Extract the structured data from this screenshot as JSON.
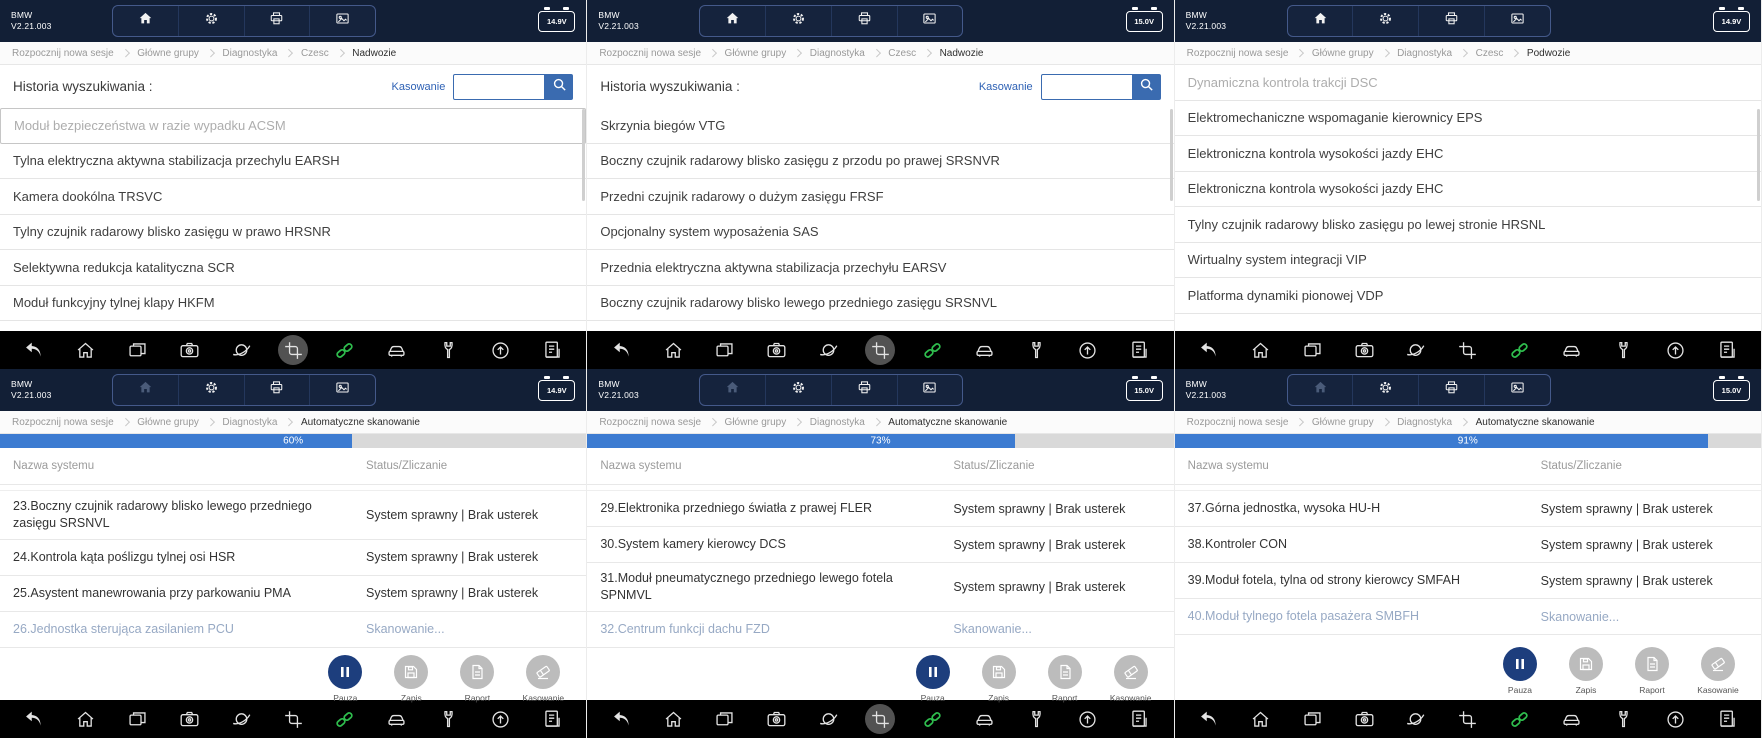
{
  "app": {
    "brand": "BMW",
    "version": "V2.21.003"
  },
  "labels": {
    "history": "Historia wyszukiwania :",
    "clear": "Kasowanie",
    "col_system": "Nazwa systemu",
    "col_status": "Status/Zliczanie",
    "actions": [
      "Pauza",
      "Zapis",
      "Raport",
      "Kasowanie"
    ]
  },
  "icons": {
    "top_nav": [
      "home-icon",
      "settings-icon",
      "printer-icon",
      "gallery-icon"
    ],
    "system_bar": [
      "back-icon",
      "home-icon",
      "recent-apps-icon",
      "screenshot-icon",
      "clean-icon",
      "crop-icon",
      "link-icon",
      "vehicle-icon",
      "tools-icon",
      "update-icon",
      "report-icon"
    ],
    "search": "magnifier-icon",
    "actions": [
      "pause-icon",
      "save-icon",
      "report-icon",
      "eraser-icon"
    ]
  },
  "colors": {
    "header_navy": "#121f36",
    "accent_blue": "#3a6bb0",
    "progress_blue": "#3c7bd1",
    "pause_navy": "#1d3e7d",
    "link_green": "#2fbe4e",
    "scanning_text": "#97a9c4"
  },
  "panels": [
    {
      "type": "list",
      "battery": "14.9V",
      "home_dimmed": false,
      "crop_ripple": true,
      "has_search": true,
      "breadcrumb": [
        "Rozpocznij nowa sesje",
        "Główne grupy",
        "Diagnostyka",
        "Czesc",
        "Nadwozie"
      ],
      "items": [
        {
          "text": "Moduł bezpieczeństwa w razie wypadku ACSM",
          "state": "selected"
        },
        {
          "text": "Tylna elektryczna aktywna stabilizacja przechylu EARSH",
          "state": "normal"
        },
        {
          "text": "Kamera dookólna TRSVC",
          "state": "normal"
        },
        {
          "text": "Tylny czujnik radarowy blisko zasięgu w prawo HRSNR",
          "state": "normal"
        },
        {
          "text": "Selektywna redukcja katalityczna SCR",
          "state": "normal"
        },
        {
          "text": "Moduł funkcyjny tylnej klapy HKFM",
          "state": "normal"
        }
      ]
    },
    {
      "type": "list",
      "battery": "15.0V",
      "home_dimmed": false,
      "crop_ripple": true,
      "has_search": true,
      "breadcrumb": [
        "Rozpocznij nowa sesje",
        "Główne grupy",
        "Diagnostyka",
        "Czesc",
        "Nadwozie"
      ],
      "items": [
        {
          "text": "Skrzynia biegów VTG",
          "state": "normal"
        },
        {
          "text": "Boczny czujnik radarowy blisko zasięgu z przodu po prawej SRSNVR",
          "state": "normal"
        },
        {
          "text": "Przedni czujnik radarowy o dużym zasięgu FRSF",
          "state": "normal"
        },
        {
          "text": "Opcjonalny system wyposażenia SAS",
          "state": "normal"
        },
        {
          "text": "Przednia elektryczna aktywna stabilizacja przechyłu EARSV",
          "state": "normal"
        },
        {
          "text": "Boczny czujnik radarowy blisko lewego przedniego zasięgu SRSNVL",
          "state": "normal"
        }
      ]
    },
    {
      "type": "list",
      "battery": "14.9V",
      "home_dimmed": false,
      "crop_ripple": false,
      "has_search": false,
      "breadcrumb": [
        "Rozpocznij nowa sesje",
        "Główne grupy",
        "Diagnostyka",
        "Czesc",
        "Podwozie"
      ],
      "items": [
        {
          "text": "Dynamiczna kontrola trakcji DSC",
          "state": "dimmed"
        },
        {
          "text": "Elektromechaniczne wspomaganie kierownicy EPS",
          "state": "normal"
        },
        {
          "text": "Elektroniczna kontrola wysokości jazdy EHC",
          "state": "normal"
        },
        {
          "text": "Elektroniczna kontrola wysokości jazdy EHC",
          "state": "normal"
        },
        {
          "text": "Tylny czujnik radarowy blisko zasięgu po lewej stronie HRSNL",
          "state": "normal"
        },
        {
          "text": "Wirtualny system integracji VIP",
          "state": "normal"
        },
        {
          "text": "Platforma dynamiki pionowej VDP",
          "state": "normal"
        }
      ]
    },
    {
      "type": "scan",
      "battery": "14.9V",
      "home_dimmed": true,
      "crop_ripple": false,
      "breadcrumb": [
        "Rozpocznij nowa sesje",
        "Główne grupy",
        "Diagnostyka",
        "Automatyczne skanowanie"
      ],
      "progress": {
        "value": 60,
        "label": "60%"
      },
      "rows": [
        {
          "name": "23.Boczny czujnik radarowy blisko lewego przedniego zasięgu SRSNVL",
          "status": "System sprawny | Brak usterek",
          "state": "ok"
        },
        {
          "name": "24.Kontrola kąta poślizgu tylnej osi HSR",
          "status": "System sprawny | Brak usterek",
          "state": "ok"
        },
        {
          "name": "25.Asystent manewrowania przy parkowaniu PMA",
          "status": "System sprawny | Brak usterek",
          "state": "ok"
        },
        {
          "name": "26.Jednostka sterująca zasilaniem PCU",
          "status": "Skanowanie...",
          "state": "scanning"
        }
      ]
    },
    {
      "type": "scan",
      "battery": "15.0V",
      "home_dimmed": true,
      "crop_ripple": true,
      "breadcrumb": [
        "Rozpocznij nowa sesje",
        "Główne grupy",
        "Diagnostyka",
        "Automatyczne skanowanie"
      ],
      "progress": {
        "value": 73,
        "label": "73%"
      },
      "rows": [
        {
          "name": "29.Elektronika przedniego światła z prawej FLER",
          "status": "System sprawny | Brak usterek",
          "state": "ok"
        },
        {
          "name": "30.System kamery kierowcy DCS",
          "status": "System sprawny | Brak usterek",
          "state": "ok"
        },
        {
          "name": "31.Moduł pneumatycznego przedniego lewego fotela SPNMVL",
          "status": "System sprawny | Brak usterek",
          "state": "ok"
        },
        {
          "name": "32.Centrum funkcji dachu FZD",
          "status": "Skanowanie...",
          "state": "scanning"
        }
      ]
    },
    {
      "type": "scan",
      "battery": "15.0V",
      "home_dimmed": true,
      "crop_ripple": false,
      "breadcrumb": [
        "Rozpocznij nowa sesje",
        "Główne grupy",
        "Diagnostyka",
        "Automatyczne skanowanie"
      ],
      "progress": {
        "value": 91,
        "label": "91%"
      },
      "rows": [
        {
          "name": "37.Górna jednostka, wysoka HU-H",
          "status": "System sprawny | Brak usterek",
          "state": "ok"
        },
        {
          "name": "38.Kontroler CON",
          "status": "System sprawny | Brak usterek",
          "state": "ok"
        },
        {
          "name": "39.Moduł fotela, tylna od strony kierowcy SMFAH",
          "status": "System sprawny | Brak usterek",
          "state": "ok"
        },
        {
          "name": "40.Moduł tylnego fotela pasażera SMBFH",
          "status": "Skanowanie...",
          "state": "scanning"
        }
      ]
    }
  ]
}
